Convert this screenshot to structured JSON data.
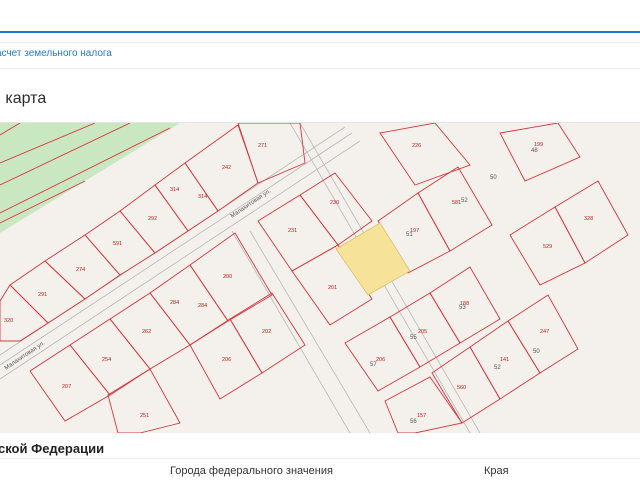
{
  "header": {
    "accent_color": "#1877d2"
  },
  "breadcrumb": {
    "link_label": "асчет земельного налога"
  },
  "section": {
    "title": "и карта"
  },
  "map": {
    "background": "#f4f1ec",
    "selected_fill": "#f7e29a",
    "parcel_stroke": "#d9363e",
    "streets": [
      "Малахитовая ул.",
      "Малахитовая ул."
    ],
    "lots": [
      "271",
      "242",
      "314",
      "314",
      "292",
      "591",
      "274",
      "291",
      "320",
      "230",
      "231",
      "201",
      "200",
      "284",
      "284",
      "262",
      "254",
      "207",
      "206",
      "202",
      "251",
      "226",
      "199",
      "581",
      "197",
      "529",
      "328",
      "188",
      "205",
      "206",
      "141",
      "247",
      "560",
      "157"
    ],
    "house_numbers": [
      "48",
      "50",
      "52",
      "51",
      "53",
      "55",
      "57",
      "50",
      "52",
      "56"
    ]
  },
  "footer": {
    "title": "йской Федерации",
    "column_a": "Города федерального значения",
    "column_b": "Края"
  }
}
